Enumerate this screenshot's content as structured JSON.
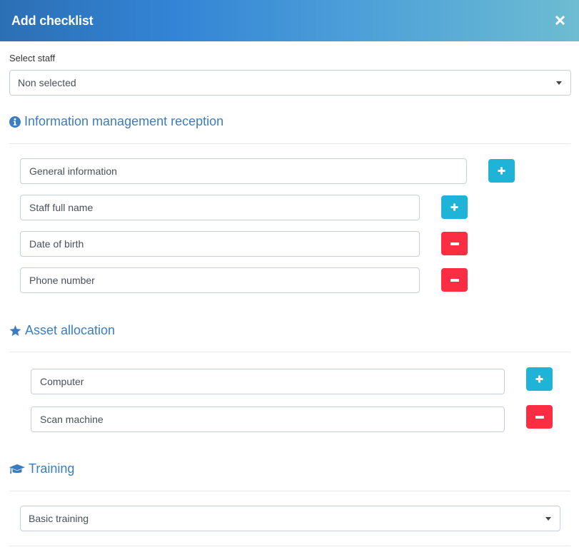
{
  "modal": {
    "title": "Add checklist",
    "close_icon": "close-icon"
  },
  "staff": {
    "label": "Select staff",
    "selected": "Non selected"
  },
  "sections": [
    {
      "title": "Information management reception",
      "icon": "info-circle-icon",
      "items": [
        {
          "value": "General information",
          "action": "add"
        },
        {
          "value": "Staff full name",
          "action": "add"
        },
        {
          "value": "Date of birth",
          "action": "remove"
        },
        {
          "value": "Phone number",
          "action": "remove"
        }
      ]
    },
    {
      "title": "Asset allocation",
      "icon": "star-icon",
      "items": [
        {
          "value": "Computer",
          "action": "add"
        },
        {
          "value": "Scan machine",
          "action": "remove"
        }
      ]
    },
    {
      "title": "Training",
      "icon": "graduation-cap-icon",
      "selected": "Basic training"
    }
  ],
  "colors": {
    "header_gradient_start": "#2c6fb4",
    "header_gradient_end": "#6dbcd2",
    "section_title": "#3b7dbf",
    "add_button": "#1fb3d8",
    "remove_button": "#fb2d42"
  }
}
